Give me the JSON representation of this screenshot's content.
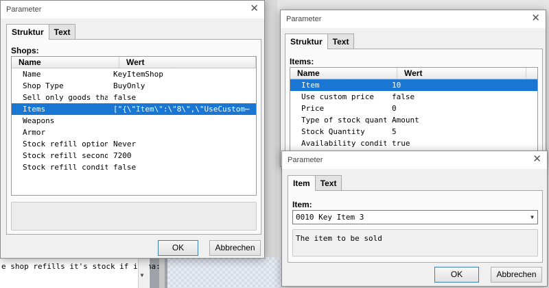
{
  "background": {
    "strip_text": "e shop refills it's stock if it ha:"
  },
  "shops_dialog": {
    "title": "Parameter",
    "tabs": [
      "Struktur",
      "Text"
    ],
    "group_label": "Shops:",
    "columns": [
      "Name",
      "Wert"
    ],
    "rows": [
      {
        "name": "Name",
        "value": "KeyItemShop"
      },
      {
        "name": "Shop Type",
        "value": "BuyOnly"
      },
      {
        "name": "Sell only goods that⋯",
        "value": "false"
      },
      {
        "name": "Items",
        "value": "[\"{\\\"Item\\\":\\\"8\\\",\\\"UseCustom⋯"
      },
      {
        "name": "Weapons",
        "value": ""
      },
      {
        "name": "Armor",
        "value": ""
      },
      {
        "name": "Stock refill option",
        "value": "Never"
      },
      {
        "name": "Stock refill seconds",
        "value": "7200"
      },
      {
        "name": "Stock refill condition",
        "value": "false"
      }
    ],
    "selected_row": 3,
    "ok_label": "OK",
    "cancel_label": "Abbrechen"
  },
  "items_dialog": {
    "title": "Parameter",
    "tabs": [
      "Struktur",
      "Text"
    ],
    "group_label": "Items:",
    "columns": [
      "Name",
      "Wert"
    ],
    "rows": [
      {
        "name": "Item",
        "value": "10"
      },
      {
        "name": "Use custom price",
        "value": "false"
      },
      {
        "name": "Price",
        "value": "0"
      },
      {
        "name": "Type of stock quantity",
        "value": "Amount"
      },
      {
        "name": "Stock Quantity",
        "value": "5"
      },
      {
        "name": "Availability condition",
        "value": "true"
      }
    ],
    "selected_row": 0
  },
  "item_dialog": {
    "title": "Parameter",
    "tabs": [
      "Item",
      "Text"
    ],
    "group_label": "Item:",
    "select_value": "0010 Key Item 3",
    "description": "The item to be sold",
    "ok_label": "OK",
    "cancel_label": "Abbrechen"
  },
  "icons": {
    "close": "close-icon",
    "dropdown": "chevron-down-icon",
    "scroll_down": "scroll-down-arrow-icon"
  },
  "colors": {
    "selection": "#1976d2"
  }
}
